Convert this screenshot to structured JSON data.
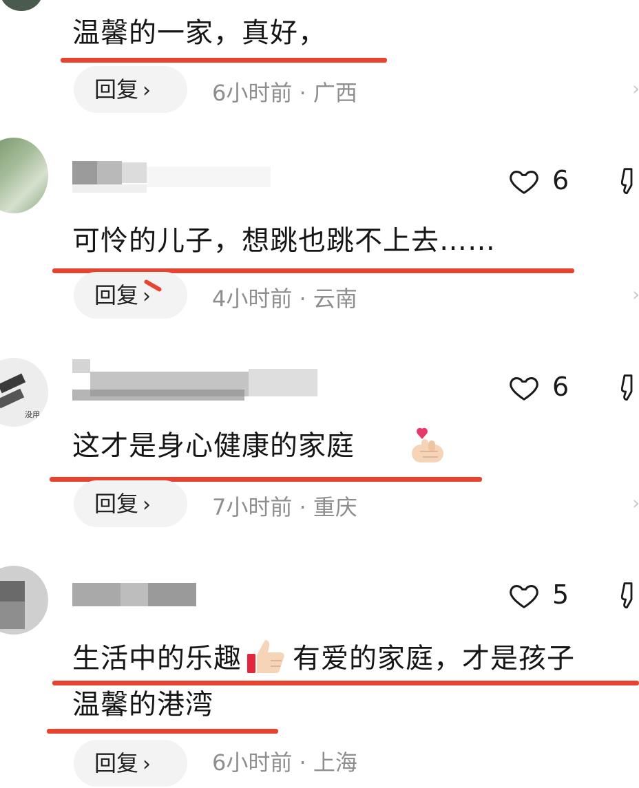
{
  "comments": [
    {
      "text": "温馨的一家，真好，",
      "reply_label": "回复",
      "meta": "6小时前 · 广西"
    },
    {
      "text": "可怜的儿子，想跳也跳不上去……",
      "reply_label": "回复",
      "meta": "4小时前 · 云南",
      "likes": "6"
    },
    {
      "avatar_caption": "没用",
      "text": "这才是身心健康的家庭",
      "reply_label": "回复",
      "meta": "7小时前 · 重庆",
      "likes": "6",
      "emoji": "finger-heart-emoji"
    },
    {
      "text_part1": "生活中的乐趣",
      "text_part2": "有爱的家庭，才是孩子",
      "text_line2": "温馨的港湾",
      "reply_label": "回复",
      "meta": "6小时前 · 上海",
      "likes": "5",
      "emoji": "thumbs-up-emoji"
    }
  ],
  "icons": {
    "like": "heart-outline-icon",
    "dislike": "thumbs-down-outline-icon",
    "chevron": "chevron-right-icon"
  },
  "colors": {
    "underline": "#e8432f",
    "meta_text": "#8e8e8e",
    "reply_bg": "#f3f3f3"
  }
}
